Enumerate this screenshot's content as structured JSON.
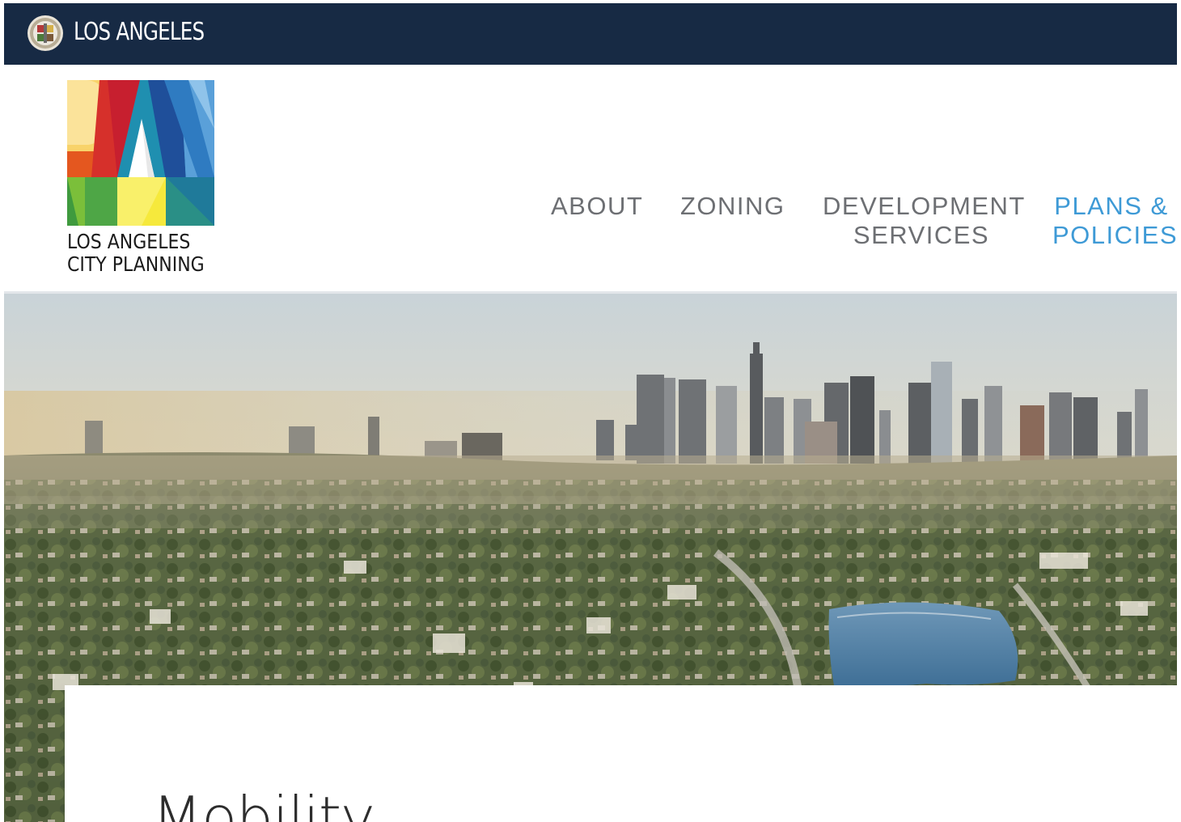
{
  "city_bar": {
    "title": "LOS ANGELES",
    "seal_icon": "city-seal-icon"
  },
  "header": {
    "logo_line1": "LOS ANGELES",
    "logo_line2": "CITY PLANNING"
  },
  "nav": {
    "items": [
      {
        "line1": "ABOUT",
        "line2": "",
        "active": false
      },
      {
        "line1": "ZONING",
        "line2": "",
        "active": false
      },
      {
        "line1": "DEVELOPMENT",
        "line2": "SERVICES",
        "active": false
      },
      {
        "line1": "PLANS &",
        "line2": "POLICIES",
        "active": true
      }
    ]
  },
  "main": {
    "page_title": "Mobility"
  },
  "colors": {
    "city_bar": "#172a44",
    "nav_text": "#6d6f73",
    "nav_active": "#3e9ad6"
  }
}
